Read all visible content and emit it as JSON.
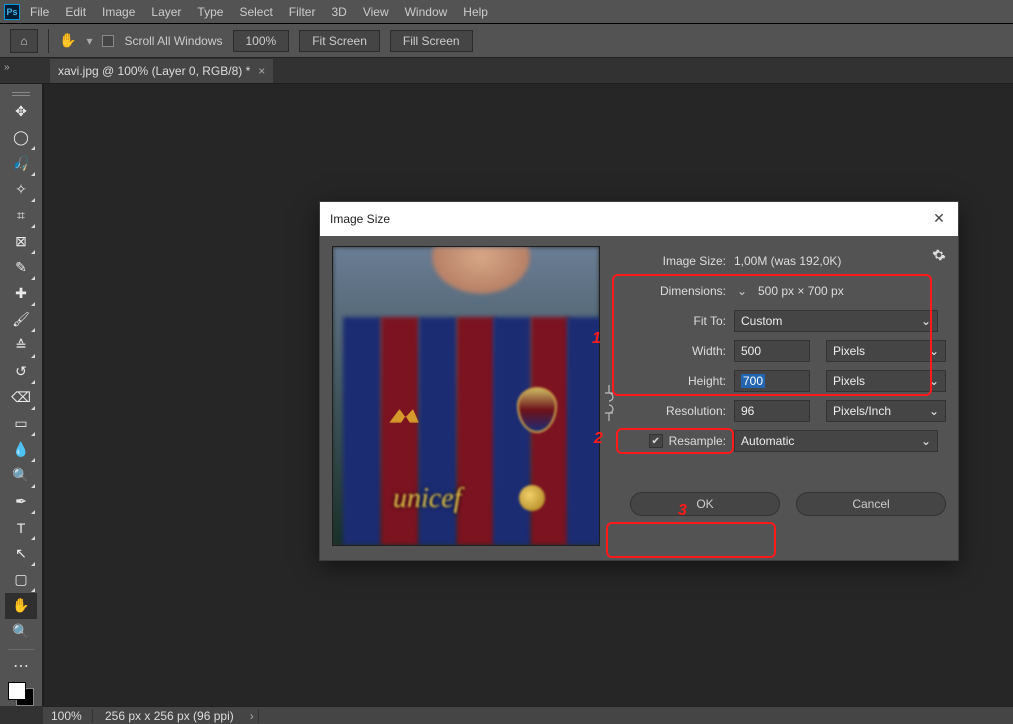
{
  "app": {
    "abbr": "Ps"
  },
  "menu": [
    "File",
    "Edit",
    "Image",
    "Layer",
    "Type",
    "Select",
    "Filter",
    "3D",
    "View",
    "Window",
    "Help"
  ],
  "options": {
    "scroll_all": "Scroll All Windows",
    "zoom": "100%",
    "fit_screen": "Fit Screen",
    "fill_screen": "Fill Screen"
  },
  "tab": {
    "title": "xavi.jpg @ 100% (Layer 0, RGB/8) *"
  },
  "status": {
    "zoom": "100%",
    "doc": "256 px x 256 px (96 ppi)"
  },
  "tools_named": [
    "move",
    "marquee",
    "lasso",
    "magic-wand",
    "crop",
    "frame",
    "eyedropper",
    "healing-brush",
    "brush",
    "clone-stamp",
    "history-brush",
    "eraser",
    "gradient",
    "blur",
    "dodge",
    "pen",
    "type",
    "path-selection",
    "rectangle",
    "hand",
    "zoom"
  ],
  "tool_glyphs": [
    "✥",
    "◯",
    "🎣",
    "✧",
    "⌗",
    "⊠",
    "✎",
    "✚",
    "🖌",
    "≙",
    "↺",
    "⌫",
    "▭",
    "💧",
    "🔍",
    "✒",
    "T",
    "↖",
    "▢",
    "✋",
    "🔍"
  ],
  "dialog": {
    "title": "Image Size",
    "image_size_label": "Image Size:",
    "image_size_value": "1,00M (was 192,0K)",
    "dimensions_label": "Dimensions:",
    "dimensions_value": "500 px  ×  700 px",
    "fit_to_label": "Fit To:",
    "fit_to_value": "Custom",
    "width_label": "Width:",
    "width_value": "500",
    "width_unit": "Pixels",
    "height_label": "Height:",
    "height_value": "700",
    "height_unit": "Pixels",
    "resolution_label": "Resolution:",
    "resolution_value": "96",
    "resolution_unit": "Pixels/Inch",
    "resample_label": "Resample:",
    "resample_value": "Automatic",
    "ok": "OK",
    "cancel": "Cancel",
    "preview_sponsor": "unicef"
  },
  "annotation": {
    "1": "1",
    "2": "2",
    "3": "3"
  }
}
